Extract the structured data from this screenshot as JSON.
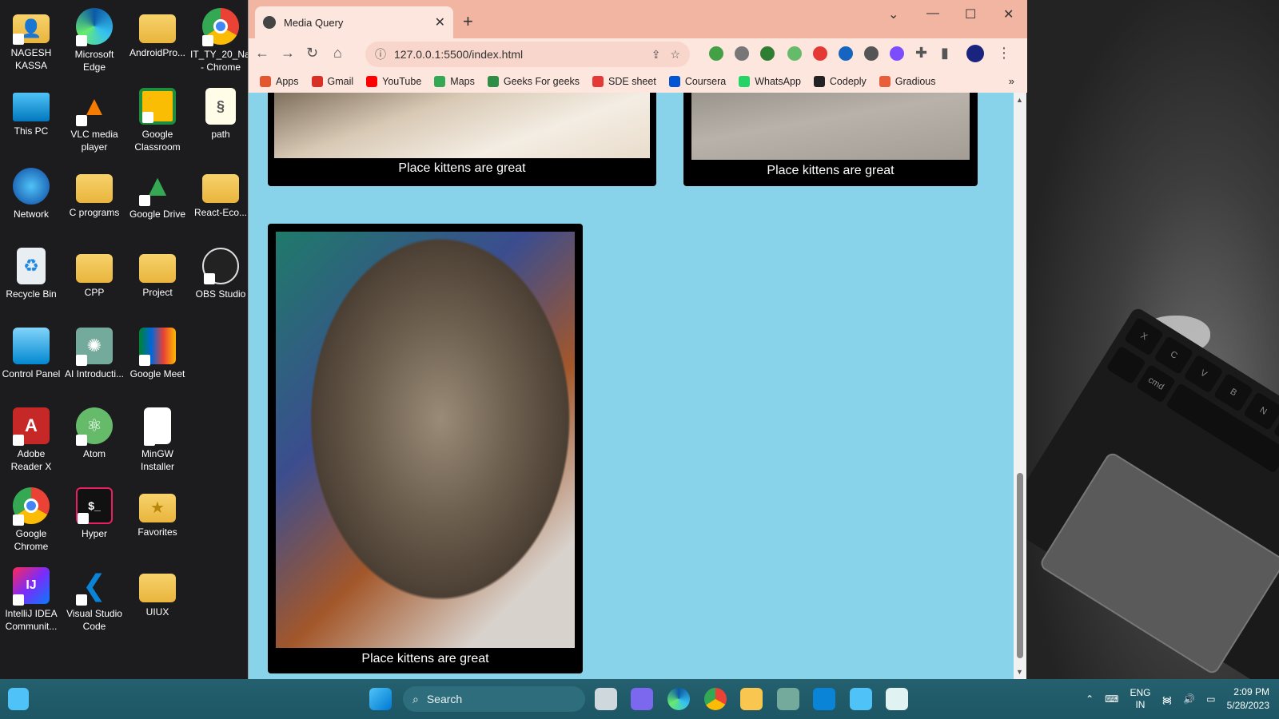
{
  "desktop": {
    "icons": [
      {
        "label": "NAGESH KASSA",
        "icon": "user-folder-icon"
      },
      {
        "label": "Microsoft Edge",
        "icon": "edge-icon"
      },
      {
        "label": "AndroidPro...",
        "icon": "folder-icon"
      },
      {
        "label": "IT_TY_20_Na... - Chrome",
        "icon": "chrome-icon"
      },
      {
        "label": "This PC",
        "icon": "monitor-icon"
      },
      {
        "label": "VLC media player",
        "icon": "vlc-icon"
      },
      {
        "label": "Google Classroom",
        "icon": "classroom-icon"
      },
      {
        "label": "path",
        "icon": "script-icon"
      },
      {
        "label": "Network",
        "icon": "network-icon"
      },
      {
        "label": "C programs",
        "icon": "folder-icon"
      },
      {
        "label": "Google Drive",
        "icon": "drive-icon"
      },
      {
        "label": "React-Eco...",
        "icon": "folder-icon"
      },
      {
        "label": "Recycle Bin",
        "icon": "recycle-bin-icon"
      },
      {
        "label": "CPP",
        "icon": "folder-icon"
      },
      {
        "label": "Project",
        "icon": "folder-icon"
      },
      {
        "label": "OBS Studio",
        "icon": "obs-icon"
      },
      {
        "label": "Control Panel",
        "icon": "control-panel-icon"
      },
      {
        "label": "AI Introducti...",
        "icon": "chatgpt-icon"
      },
      {
        "label": "Google Meet",
        "icon": "meet-icon"
      },
      {
        "label": "Adobe Reader X",
        "icon": "adobe-icon"
      },
      {
        "label": "Atom",
        "icon": "atom-icon"
      },
      {
        "label": "MinGW Installer",
        "icon": "file-icon"
      },
      {
        "label": "Google Chrome",
        "icon": "chrome-icon"
      },
      {
        "label": "Hyper",
        "icon": "terminal-icon"
      },
      {
        "label": "Favorites",
        "icon": "star-folder-icon"
      },
      {
        "label": "IntelliJ IDEA Communit...",
        "icon": "intellij-icon"
      },
      {
        "label": "Visual Studio Code",
        "icon": "vscode-icon"
      },
      {
        "label": "UIUX",
        "icon": "folder-icon"
      }
    ],
    "keyboard_keys": [
      "X",
      "C",
      "V",
      "B",
      "N",
      "?",
      "cmd"
    ]
  },
  "browser": {
    "tab_title": "Media Query",
    "tab_close": "✕",
    "new_tab": "+",
    "window_controls": {
      "dropdown": "⌄",
      "minimize": "—",
      "maximize": "☐",
      "close": "✕"
    },
    "url": "127.0.0.1:5500/index.html",
    "bookmarks": [
      {
        "label": "Apps",
        "color": "#e4572e"
      },
      {
        "label": "Gmail",
        "color": "#d93025"
      },
      {
        "label": "YouTube",
        "color": "#ff0000"
      },
      {
        "label": "Maps",
        "color": "#34a853"
      },
      {
        "label": "Geeks For geeks",
        "color": "#2f8d46"
      },
      {
        "label": "SDE sheet",
        "color": "#e53935"
      },
      {
        "label": "Coursera",
        "color": "#0056d2"
      },
      {
        "label": "WhatsApp",
        "color": "#25d366"
      },
      {
        "label": "Codeply",
        "color": "#222222"
      },
      {
        "label": "Gradious",
        "color": "#e85d3a"
      }
    ],
    "bookmarks_more": "»"
  },
  "page": {
    "background": "#88d3ea",
    "cards": [
      {
        "caption": "Place kittens are great"
      },
      {
        "caption": "Place kittens are great"
      },
      {
        "caption": "Place kittens are great"
      }
    ]
  },
  "taskbar": {
    "search_label": "Search",
    "language": "ENG",
    "region": "IN",
    "time": "2:09 PM",
    "date": "5/28/2023"
  }
}
